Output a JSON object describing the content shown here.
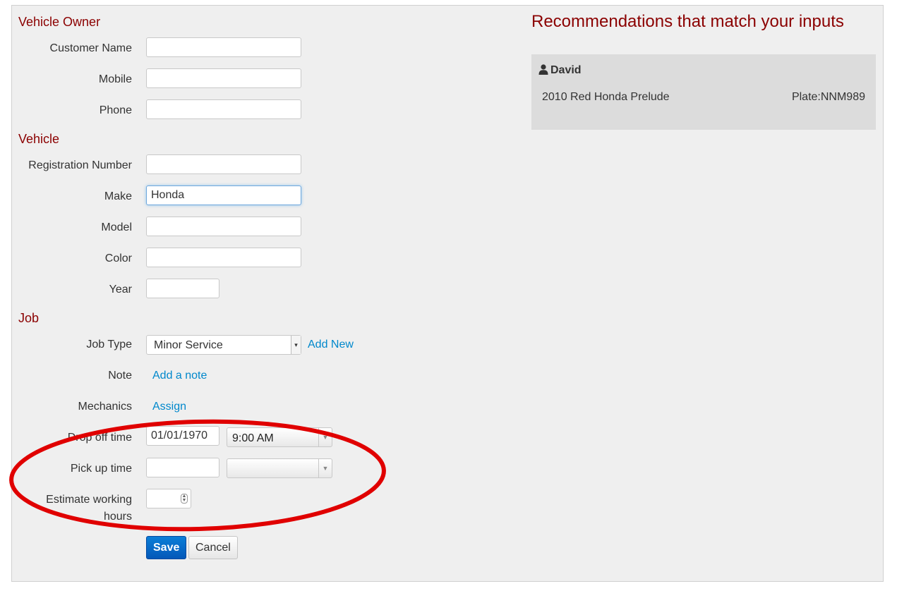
{
  "sections": {
    "owner": "Vehicle Owner",
    "vehicle": "Vehicle",
    "job": "Job"
  },
  "owner": {
    "customer_name_label": "Customer Name",
    "customer_name_value": "",
    "mobile_label": "Mobile",
    "mobile_value": "",
    "phone_label": "Phone",
    "phone_value": ""
  },
  "vehicle": {
    "registration_label": "Registration Number",
    "registration_value": "",
    "make_label": "Make",
    "make_value": "Honda",
    "model_label": "Model",
    "model_value": "",
    "color_label": "Color",
    "color_value": "",
    "year_label": "Year",
    "year_value": ""
  },
  "job": {
    "job_type_label": "Job Type",
    "job_type_value": "Minor Service",
    "add_new_link": "Add New",
    "note_label": "Note",
    "add_note_link": "Add a note",
    "mechanics_label": "Mechanics",
    "assign_link": "Assign",
    "drop_off_label": "Drop off time",
    "drop_off_date": "01/01/1970",
    "drop_off_time": "9:00 AM",
    "pick_up_label": "Pick up time",
    "pick_up_date": "",
    "pick_up_time": "",
    "estimate_label_line1": "Estimate working",
    "estimate_label_line2": "hours",
    "estimate_value": ""
  },
  "actions": {
    "save": "Save",
    "cancel": "Cancel"
  },
  "recommendations": {
    "title": "Recommendations that match your inputs",
    "items": [
      {
        "owner": "David",
        "vehicle": "2010 Red Honda Prelude",
        "plate": "Plate:NNM989"
      }
    ]
  },
  "annotation_color": "#e00000",
  "icons": {
    "user": "user-icon",
    "select_arrow": "caret-down-icon",
    "spinner": "number-spinner-icon"
  }
}
